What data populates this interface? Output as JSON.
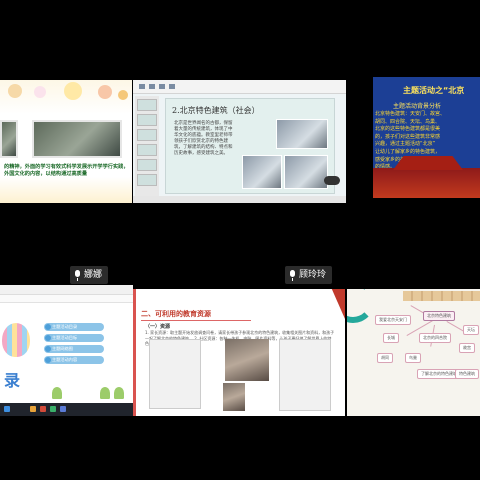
{
  "participants": [
    {
      "name": "娜娜"
    },
    {
      "name": "顾玲玲"
    }
  ],
  "tile1": {
    "caption": "的精神，外面的学习有效式科学发展示开学学行实践，外国文化的内容，以结构通过高质量"
  },
  "tile2": {
    "slide_title": "2.北京特色建筑（社会）",
    "slide_text": "北京是世界闻名的古都，保留着大量的传统建筑，体现了中华文化的底蕴。教室里老师带领孩子们欣赏北京的特色建筑，了解建筑的结构、特点和历史故事，感受建筑之美。"
  },
  "tile3": {
    "title": "主题活动之“北京",
    "subtitle": "主题活动背景分析",
    "lines": [
      "北京特色建筑：天安门、故宫、",
      "胡同、四合院、天坛、鸟巢、",
      "北京的这些特色建筑都是很美",
      "的，孩子们对这些建筑非常感",
      "兴趣，通过主题活动“北京”",
      "让幼儿了解家乡的特色建筑，",
      "感受家乡的美好，激发爱家乡",
      "的情感。"
    ]
  },
  "tile4": {
    "big_char": "录",
    "menu": [
      "主题活动目录",
      "主题活动目标",
      "主题网络图",
      "主题活动内容"
    ]
  },
  "tile5": {
    "heading": "二、可利用的教育资源",
    "sub": "（一）资源",
    "body": "1. 家长资源：取主题开始发放调查问卷，请家长带孩子参观北京的特色建筑，收集相关图片和资料，和孩子一起了解北京的特色建筑。 2. 社区资源：各种一体机、电脑、图片资料等，让孩子更好地了解世界上的特色建筑。"
  },
  "tile6": {
    "center": "北京特色建筑",
    "nodes": [
      "我爱北京天安门",
      "天坛",
      "长城",
      "北京的四合院",
      "故宫",
      "胡同",
      "鸟巢",
      "了解北京的特色建筑",
      "特色建筑"
    ]
  },
  "colors": {
    "name_label_bg": "#2b2b2b",
    "slide_blue": "#1c3f95",
    "title_yellow": "#ffe45c",
    "heading_red": "#c0392b",
    "teal": "#24a89b"
  }
}
